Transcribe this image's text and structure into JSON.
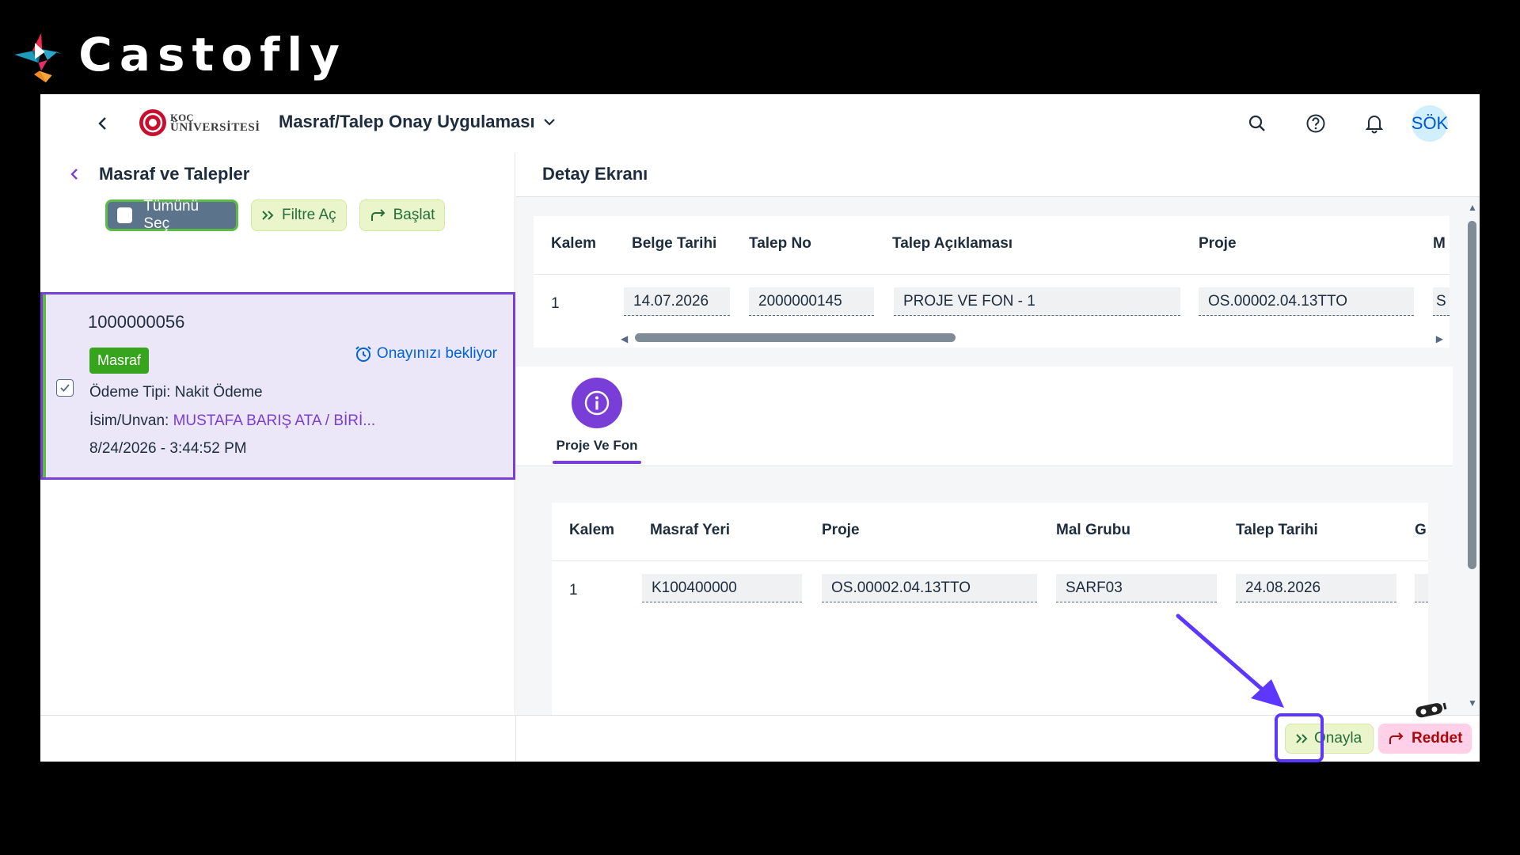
{
  "brand": {
    "name": "Castofly"
  },
  "shell": {
    "logo_line1": "KOÇ",
    "logo_line2": "ÜNİVERSİTESİ",
    "app_title": "Masraf/Talep Onay Uygulaması",
    "avatar_initials": "SÖK"
  },
  "master": {
    "title": "Masraf ve Talepler",
    "toolbar": {
      "select_all": "Tümünü Seç",
      "filter": "Filtre Aç",
      "start": "Başlat"
    },
    "item": {
      "id": "1000000056",
      "tag": "Masraf",
      "status": "Onayınızı bekliyor",
      "payment_label": "Ödeme Tipi:",
      "payment_value": "Nakit Ödeme",
      "name_label": "İsim/Unvan:",
      "name_value": "MUSTAFA BARIŞ ATA / BİRİ...",
      "datetime": "8/24/2026 - 3:44:52 PM"
    }
  },
  "detail": {
    "title": "Detay Ekranı",
    "table1": {
      "headers": [
        "Kalem",
        "Belge Tarihi",
        "Talep No",
        "Talep Açıklaması",
        "Proje",
        "M"
      ],
      "row": [
        "1",
        "14.07.2026",
        "2000000145",
        "PROJE VE FON - 1",
        "OS.00002.04.13TTO",
        "S"
      ]
    },
    "tab": {
      "label": "Proje Ve Fon",
      "icon_char": "i"
    },
    "table2": {
      "headers": [
        "Kalem",
        "Masraf Yeri",
        "Proje",
        "Mal Grubu",
        "Talep Tarihi",
        "G"
      ],
      "row": [
        "1",
        "K100400000",
        "OS.00002.04.13TTO",
        "SARF03",
        "24.08.2026",
        ""
      ]
    }
  },
  "footer": {
    "approve": "Onayla",
    "reject": "Reddet"
  },
  "colors": {
    "accent": "#7a3ed8",
    "approve_bg": "#ebf5cb",
    "reject_bg": "#ffd0e7",
    "annotation": "#5d36ff"
  }
}
